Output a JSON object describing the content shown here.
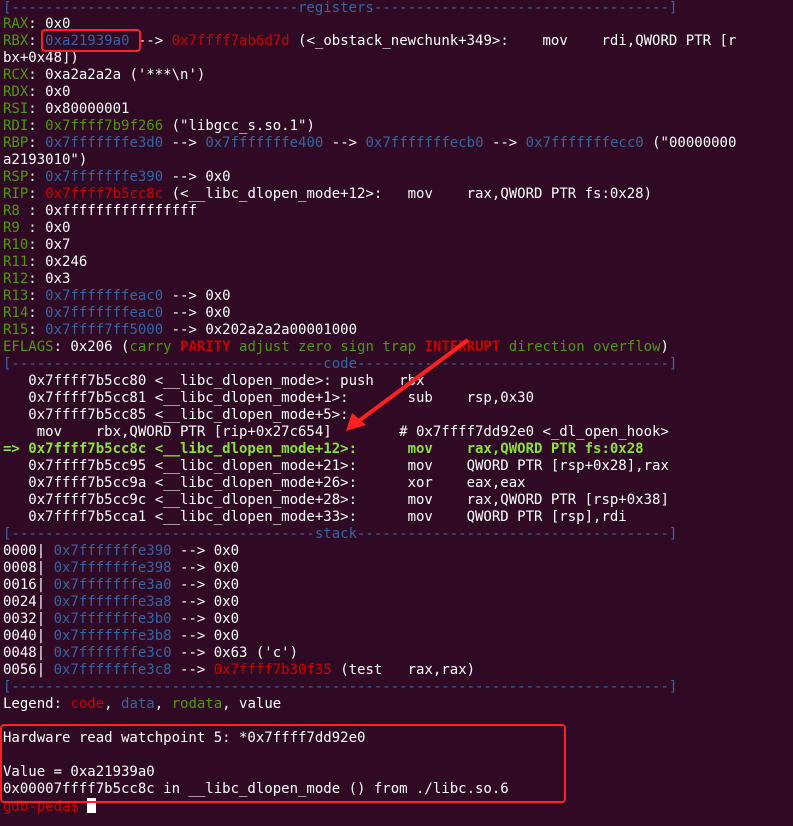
{
  "sep_registers": "[----------------------------------registers-----------------------------------]",
  "sep_code": "[-------------------------------------code-------------------------------------]",
  "sep_stack": "[------------------------------------stack-------------------------------------]",
  "sep_end": "[------------------------------------------------------------------------------]",
  "regs": {
    "rax": {
      "name": "RAX",
      "value": "0x0"
    },
    "rbx": {
      "name": "RBX",
      "addr": "0xa21939a0",
      "arrow": " --> ",
      "target": "0x7ffff7ab6d7d",
      "rest": " (<_obstack_newchunk+349>:    mov    rdi,QWORD PTR [r",
      "cont": "bx+0x48])"
    },
    "rcx": {
      "name": "RCX",
      "value": "0xa2a2a2a ('***\\n')"
    },
    "rdx": {
      "name": "RDX",
      "value": "0x0"
    },
    "rsi": {
      "name": "RSI",
      "value": "0x80000001"
    },
    "rdi": {
      "name": "RDI",
      "addr": "0x7ffff7b9f266",
      "rest": " (\"libgcc_s.so.1\")"
    },
    "rbp": {
      "name": "RBP",
      "a1": "0x7fffffffe3d0",
      "a2": "0x7fffffffe400",
      "a3": "0x7fffffffecb0",
      "a4": "0x7fffffffecc0",
      "rest": " (\"00000000",
      "cont": "a2193010\")"
    },
    "rsp": {
      "name": "RSP",
      "addr": "0x7fffffffe390",
      "rest": " --> 0x0"
    },
    "rip": {
      "name": "RIP",
      "addr": "0x7ffff7b5cc8c",
      "rest": " (<__libc_dlopen_mode+12>:   mov    rax,QWORD PTR fs:0x28)"
    },
    "r8": {
      "name": "R8 ",
      "value": "0xffffffffffffffff"
    },
    "r9": {
      "name": "R9 ",
      "value": "0x0"
    },
    "r10": {
      "name": "R10",
      "value": "0x7"
    },
    "r11": {
      "name": "R11",
      "value": "0x246"
    },
    "r12": {
      "name": "R12",
      "value": "0x3"
    },
    "r13": {
      "name": "R13",
      "addr": "0x7fffffffeac0",
      "rest": " --> 0x0"
    },
    "r14": {
      "name": "R14",
      "addr": "0x7fffffffeac0",
      "rest": " --> 0x0"
    },
    "r15": {
      "name": "R15",
      "addr": "0x7ffff7ff5000",
      "rest": " --> 0x202a2a2a00001000"
    }
  },
  "eflags": {
    "name": "EFLAGS",
    "value": ": 0x206 (",
    "f1": "carry",
    "f2": "PARITY",
    "f3": "adjust zero sign trap",
    "f4": "INTERRUPT",
    "f5": "direction overflow",
    "close": ")"
  },
  "code": [
    "   0x7ffff7b5cc80 <__libc_dlopen_mode>: push   rbx",
    "   0x7ffff7b5cc81 <__libc_dlopen_mode+1>:       sub    rsp,0x30",
    "   0x7ffff7b5cc85 <__libc_dlopen_mode+5>:",
    "    mov    rbx,QWORD PTR [rip+0x27c654]        # 0x7ffff7dd92e0 <_dl_open_hook>"
  ],
  "code_current": "=> 0x7ffff7b5cc8c <__libc_dlopen_mode+12>:      mov    rax,QWORD PTR fs:0x28",
  "code_after": [
    "   0x7ffff7b5cc95 <__libc_dlopen_mode+21>:      mov    QWORD PTR [rsp+0x28],rax",
    "   0x7ffff7b5cc9a <__libc_dlopen_mode+26>:      xor    eax,eax",
    "   0x7ffff7b5cc9c <__libc_dlopen_mode+28>:      mov    rax,QWORD PTR [rsp+0x38]",
    "   0x7ffff7b5cca1 <__libc_dlopen_mode+33>:      mov    QWORD PTR [rsp],rdi"
  ],
  "stack": [
    {
      "off": "0000| ",
      "addr": "0x7fffffffe390",
      "rest": " --> 0x0"
    },
    {
      "off": "0008| ",
      "addr": "0x7fffffffe398",
      "rest": " --> 0x0"
    },
    {
      "off": "0016| ",
      "addr": "0x7fffffffe3a0",
      "rest": " --> 0x0"
    },
    {
      "off": "0024| ",
      "addr": "0x7fffffffe3a8",
      "rest": " --> 0x0"
    },
    {
      "off": "0032| ",
      "addr": "0x7fffffffe3b0",
      "rest": " --> 0x0"
    },
    {
      "off": "0040| ",
      "addr": "0x7fffffffe3b8",
      "rest": " --> 0x0"
    },
    {
      "off": "0048| ",
      "addr": "0x7fffffffe3c0",
      "rest": " --> 0x63 ('c')"
    },
    {
      "off": "0056| ",
      "addr": "0x7fffffffe3c8",
      "rest": " --> ",
      "target": "0x7ffff7b30f35",
      "tail": " (test   rax,rax)"
    }
  ],
  "legend": {
    "label": "Legend: ",
    "code": "code",
    "data": "data",
    "rodata": "rodata",
    "value": "value",
    "sep": ", "
  },
  "watch": {
    "line1": "Hardware read watchpoint 5: *0x7ffff7dd92e0",
    "line2": "Value = 0xa21939a0",
    "line3": "0x00007ffff7b5cc8c in __libc_dlopen_mode () from ./libc.so.6"
  },
  "prompt": "gdb-peda$ ",
  "colors": {
    "background": "#300a24",
    "separator": "#3465a4",
    "register": "#4e9a06",
    "code_addr": "#cc0000",
    "highlight": "#ff2020"
  }
}
